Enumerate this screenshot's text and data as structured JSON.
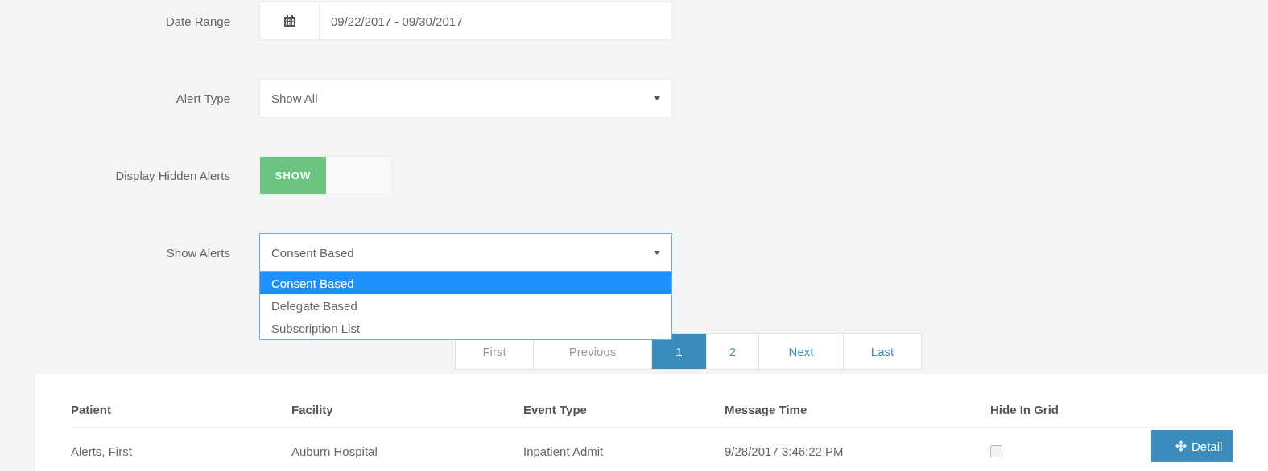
{
  "filters": [
    {
      "kind": "date",
      "label": "Date Range",
      "value": "09/22/2017 - 09/30/2017"
    },
    {
      "kind": "select",
      "label": "Alert Type",
      "value": "Show All",
      "expanded": false
    },
    {
      "kind": "toggle",
      "label": "Display Hidden Alerts",
      "toggle_text": "SHOW",
      "on": true
    },
    {
      "kind": "select",
      "label": "Show Alerts",
      "value": "Consent Based",
      "expanded": true,
      "options": [
        {
          "label": "Consent Based",
          "selected": true
        },
        {
          "label": "Delegate Based",
          "selected": false
        },
        {
          "label": "Subscription List",
          "selected": false
        }
      ]
    }
  ],
  "pagination": [
    {
      "label": "First",
      "disabled": true,
      "selected": false
    },
    {
      "label": "Previous",
      "disabled": true,
      "selected": false
    },
    {
      "label": "1",
      "disabled": false,
      "selected": true
    },
    {
      "label": "2",
      "disabled": false,
      "selected": false
    },
    {
      "label": "Next",
      "disabled": false,
      "selected": false
    },
    {
      "label": "Last",
      "disabled": false,
      "selected": false
    }
  ],
  "table": {
    "columns": [
      "Patient",
      "Facility",
      "Event Type",
      "Message Time",
      "Hide In Grid"
    ],
    "rows": [
      {
        "cells": [
          "Alerts, First",
          "Auburn Hospital",
          "Inpatient Admit",
          "9/28/2017 3:46:22 PM"
        ],
        "hidden": false,
        "action": "Detail"
      }
    ]
  }
}
